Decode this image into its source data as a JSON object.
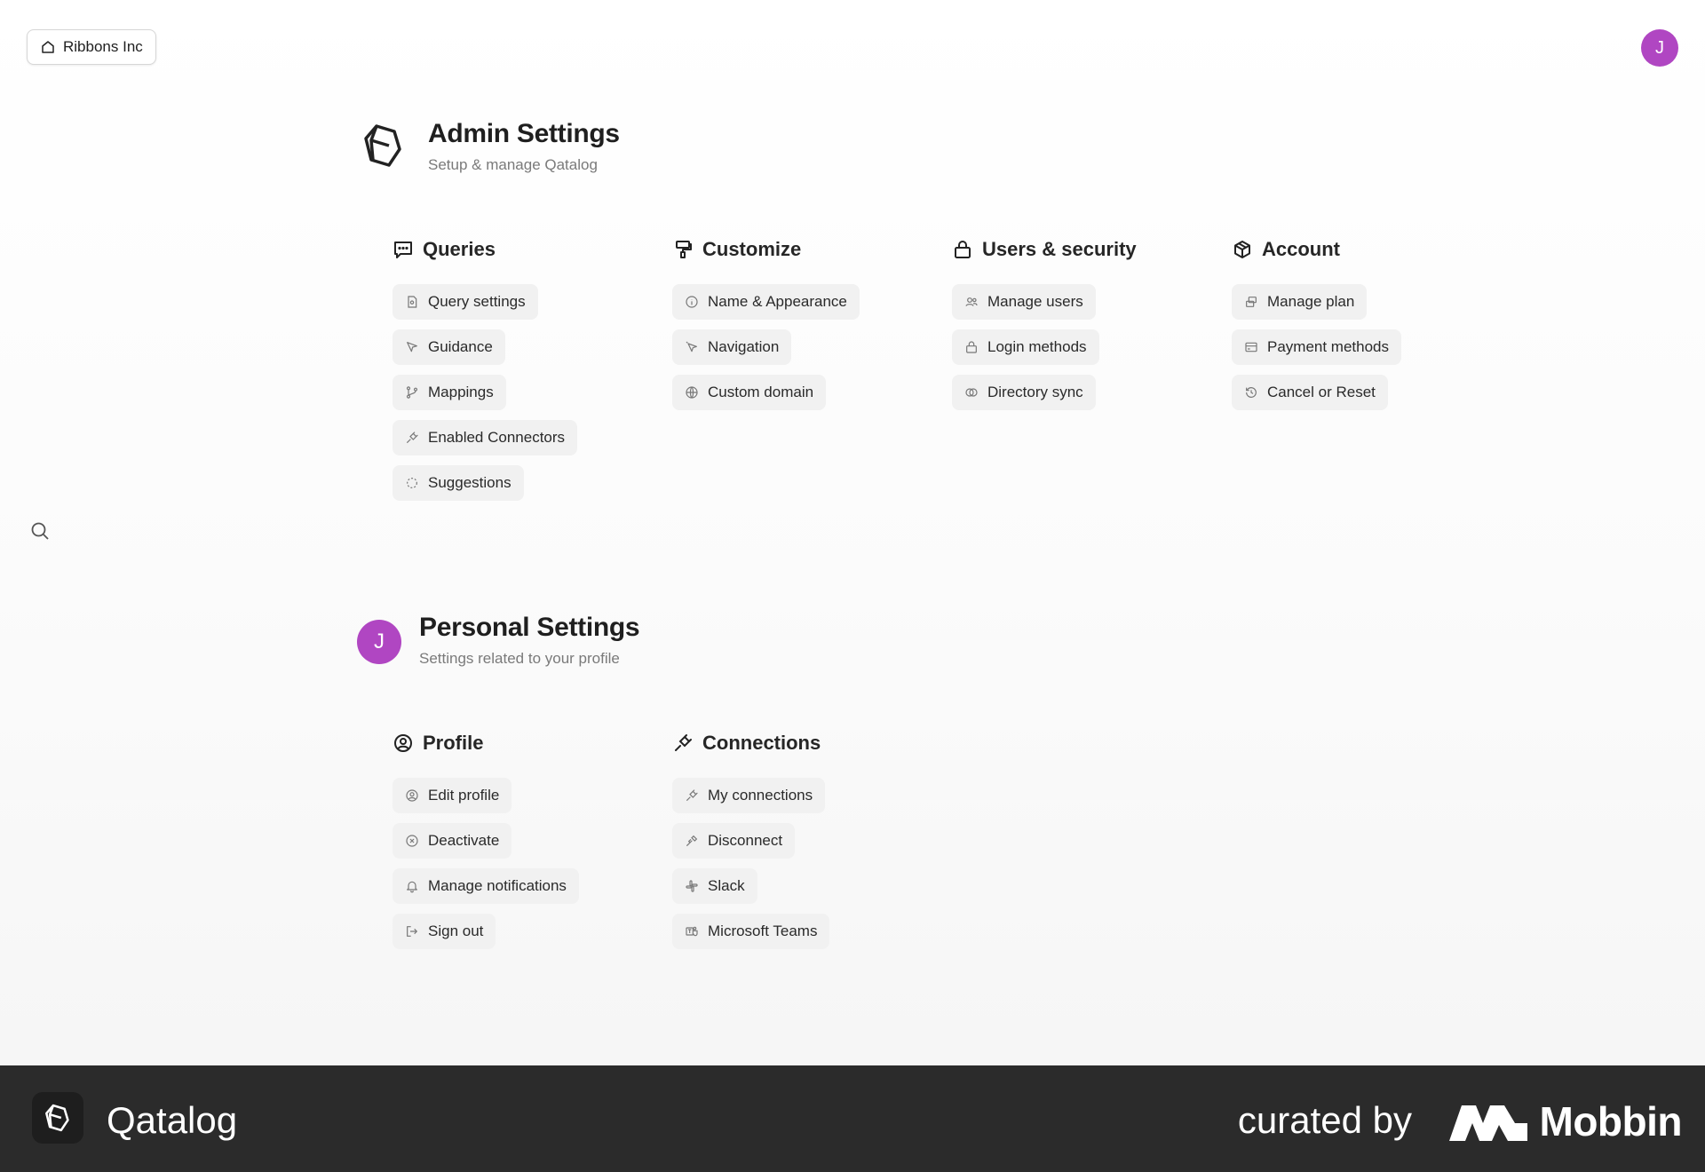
{
  "workspace": {
    "label": "Ribbons Inc"
  },
  "user": {
    "initial": "J"
  },
  "admin": {
    "title": "Admin Settings",
    "subtitle": "Setup & manage Qatalog",
    "groups": [
      {
        "title": "Queries",
        "icon": "message-square-icon",
        "items": [
          "Query settings",
          "Guidance",
          "Mappings",
          "Enabled Connectors",
          "Suggestions"
        ]
      },
      {
        "title": "Customize",
        "icon": "paint-roller-icon",
        "items": [
          "Name & Appearance",
          "Navigation",
          "Custom domain"
        ]
      },
      {
        "title": "Users & security",
        "icon": "lock-icon",
        "items": [
          "Manage users",
          "Login methods",
          "Directory sync"
        ]
      },
      {
        "title": "Account",
        "icon": "package-icon",
        "items": [
          "Manage plan",
          "Payment methods",
          "Cancel or Reset"
        ]
      }
    ]
  },
  "personal": {
    "title": "Personal Settings",
    "subtitle": "Settings related to your profile",
    "groups": [
      {
        "title": "Profile",
        "icon": "user-circle-icon",
        "items": [
          "Edit profile",
          "Deactivate",
          "Manage notifications",
          "Sign out"
        ]
      },
      {
        "title": "Connections",
        "icon": "plug-icon",
        "items": [
          "My connections",
          "Disconnect",
          "Slack",
          "Microsoft Teams"
        ]
      }
    ]
  },
  "footer": {
    "brand": "Qatalog",
    "curated": "curated by",
    "mobbin": "Mobbin"
  }
}
